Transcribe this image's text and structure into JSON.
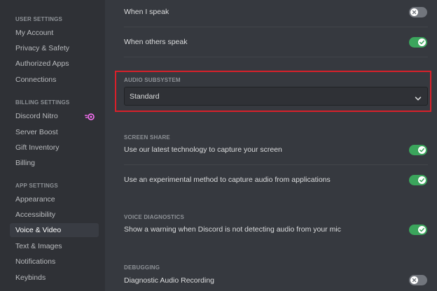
{
  "sidebar": {
    "sections": [
      {
        "header": "USER SETTINGS",
        "items": [
          "My Account",
          "Privacy & Safety",
          "Authorized Apps",
          "Connections"
        ]
      },
      {
        "header": "BILLING SETTINGS",
        "items": [
          "Discord Nitro",
          "Server Boost",
          "Gift Inventory",
          "Billing"
        ]
      },
      {
        "header": "APP SETTINGS",
        "items": [
          "Appearance",
          "Accessibility",
          "Voice & Video",
          "Text & Images",
          "Notifications",
          "Keybinds"
        ]
      }
    ],
    "active_item": "Voice & Video",
    "nitro_icon": "nitro-icon"
  },
  "main": {
    "when_i_speak": {
      "label": "When I speak",
      "enabled": false
    },
    "when_others_speak": {
      "label": "When others speak",
      "enabled": true
    },
    "audio_subsystem": {
      "label": "AUDIO SUBSYSTEM",
      "value": "Standard"
    },
    "screen_share": {
      "label": "SCREEN SHARE",
      "latest_tech": {
        "label": "Use our latest technology to capture your screen",
        "enabled": true
      },
      "experimental_audio": {
        "label": "Use an experimental method to capture audio from applications",
        "enabled": true
      }
    },
    "voice_diagnostics": {
      "label": "VOICE DIAGNOSTICS",
      "warning": {
        "label": "Show a warning when Discord is not detecting audio from your mic",
        "enabled": true
      }
    },
    "debugging": {
      "label": "DEBUGGING",
      "diagnostic_recording": {
        "label": "Diagnostic Audio Recording",
        "enabled": false
      }
    }
  },
  "colors": {
    "toggle_on": "#3ba55c",
    "toggle_off": "#72767d",
    "highlight_border": "#d9202a",
    "nitro_accent": "#ff73fa"
  }
}
